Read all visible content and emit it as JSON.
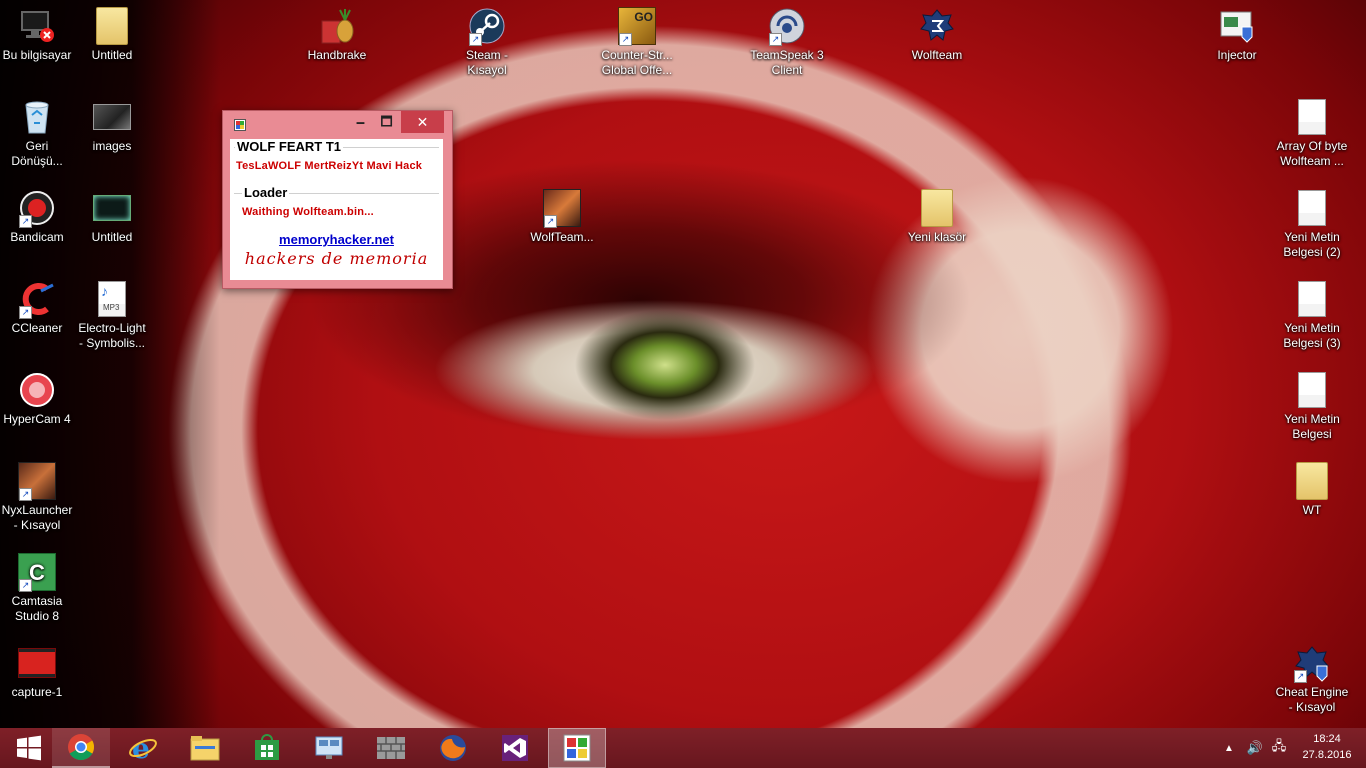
{
  "desktop_icons": {
    "this_pc": "Bu bilgisayar",
    "untitled_folder": "Untitled",
    "recycle_bin_1": "Geri",
    "recycle_bin_2": "Dönüşü...",
    "images": "images",
    "bandicam": "Bandicam",
    "untitled_video": "Untitled",
    "ccleaner": "CCleaner",
    "electro_1": "Electro-Light",
    "electro_2": "- Symbolis...",
    "hypercam": "HyperCam 4",
    "nyx_1": "NyxLauncher",
    "nyx_2": "- Kısayol",
    "camtasia_1": "Camtasia",
    "camtasia_2": "Studio 8",
    "capture": "capture-1",
    "handbrake": "Handbrake",
    "steam_1": "Steam -",
    "steam_2": "Kısayol",
    "csgo_1": "Counter-Str...",
    "csgo_2": "Global Offe...",
    "csgo_badge": "GO",
    "teamspeak_1": "TeamSpeak 3",
    "teamspeak_2": "Client",
    "wolfteam": "Wolfteam",
    "injector": "Injector",
    "wolfteam_exe": "WolfTeam...",
    "new_folder": "Yeni klasör",
    "array_1": "Array Of byte",
    "array_2": "Wolfteam ...",
    "text2_1": "Yeni Metin",
    "text2_2": "Belgesi (2)",
    "text3_1": "Yeni Metin",
    "text3_2": "Belgesi (3)",
    "text_1": "Yeni Metin",
    "text_2": "Belgesi",
    "wt": "WT",
    "cheat_1": "Cheat Engine",
    "cheat_2": "- Kısayol",
    "mp3_badge": "MP3"
  },
  "window": {
    "title": "",
    "min": "🗕",
    "max": "🗖",
    "close": "✕",
    "group1_title": "WOLF FEART T1",
    "group1_text": "TesLaWOLF MertReizYt  Mavi Hack",
    "group2_title": "Loader",
    "group2_text": "Waithing Wolfteam.bin...",
    "link": "memoryhacker.net",
    "script_text": "hackers de memoria"
  },
  "taskbar": {
    "tray_arrow": "▲",
    "volume": "🔊",
    "network": "🖧",
    "time": "18:24",
    "date": "27.8.2016"
  },
  "colors": {
    "window_frame": "#e98b94",
    "close_button": "#c83e4a",
    "status_red": "#cc0000",
    "link_blue": "#0000cc",
    "taskbar": "#780e18"
  }
}
